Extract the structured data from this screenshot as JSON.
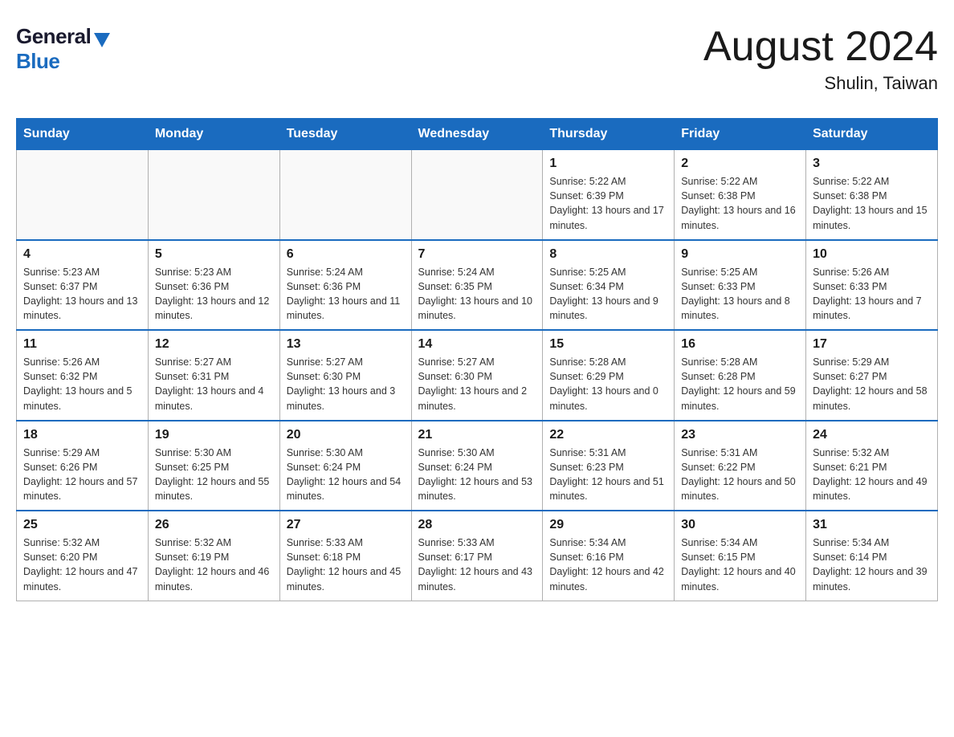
{
  "header": {
    "logo_general": "General",
    "logo_blue": "Blue",
    "month_title": "August 2024",
    "location": "Shulin, Taiwan"
  },
  "days_of_week": [
    "Sunday",
    "Monday",
    "Tuesday",
    "Wednesday",
    "Thursday",
    "Friday",
    "Saturday"
  ],
  "weeks": [
    [
      {
        "day": "",
        "info": ""
      },
      {
        "day": "",
        "info": ""
      },
      {
        "day": "",
        "info": ""
      },
      {
        "day": "",
        "info": ""
      },
      {
        "day": "1",
        "info": "Sunrise: 5:22 AM\nSunset: 6:39 PM\nDaylight: 13 hours and 17 minutes."
      },
      {
        "day": "2",
        "info": "Sunrise: 5:22 AM\nSunset: 6:38 PM\nDaylight: 13 hours and 16 minutes."
      },
      {
        "day": "3",
        "info": "Sunrise: 5:22 AM\nSunset: 6:38 PM\nDaylight: 13 hours and 15 minutes."
      }
    ],
    [
      {
        "day": "4",
        "info": "Sunrise: 5:23 AM\nSunset: 6:37 PM\nDaylight: 13 hours and 13 minutes."
      },
      {
        "day": "5",
        "info": "Sunrise: 5:23 AM\nSunset: 6:36 PM\nDaylight: 13 hours and 12 minutes."
      },
      {
        "day": "6",
        "info": "Sunrise: 5:24 AM\nSunset: 6:36 PM\nDaylight: 13 hours and 11 minutes."
      },
      {
        "day": "7",
        "info": "Sunrise: 5:24 AM\nSunset: 6:35 PM\nDaylight: 13 hours and 10 minutes."
      },
      {
        "day": "8",
        "info": "Sunrise: 5:25 AM\nSunset: 6:34 PM\nDaylight: 13 hours and 9 minutes."
      },
      {
        "day": "9",
        "info": "Sunrise: 5:25 AM\nSunset: 6:33 PM\nDaylight: 13 hours and 8 minutes."
      },
      {
        "day": "10",
        "info": "Sunrise: 5:26 AM\nSunset: 6:33 PM\nDaylight: 13 hours and 7 minutes."
      }
    ],
    [
      {
        "day": "11",
        "info": "Sunrise: 5:26 AM\nSunset: 6:32 PM\nDaylight: 13 hours and 5 minutes."
      },
      {
        "day": "12",
        "info": "Sunrise: 5:27 AM\nSunset: 6:31 PM\nDaylight: 13 hours and 4 minutes."
      },
      {
        "day": "13",
        "info": "Sunrise: 5:27 AM\nSunset: 6:30 PM\nDaylight: 13 hours and 3 minutes."
      },
      {
        "day": "14",
        "info": "Sunrise: 5:27 AM\nSunset: 6:30 PM\nDaylight: 13 hours and 2 minutes."
      },
      {
        "day": "15",
        "info": "Sunrise: 5:28 AM\nSunset: 6:29 PM\nDaylight: 13 hours and 0 minutes."
      },
      {
        "day": "16",
        "info": "Sunrise: 5:28 AM\nSunset: 6:28 PM\nDaylight: 12 hours and 59 minutes."
      },
      {
        "day": "17",
        "info": "Sunrise: 5:29 AM\nSunset: 6:27 PM\nDaylight: 12 hours and 58 minutes."
      }
    ],
    [
      {
        "day": "18",
        "info": "Sunrise: 5:29 AM\nSunset: 6:26 PM\nDaylight: 12 hours and 57 minutes."
      },
      {
        "day": "19",
        "info": "Sunrise: 5:30 AM\nSunset: 6:25 PM\nDaylight: 12 hours and 55 minutes."
      },
      {
        "day": "20",
        "info": "Sunrise: 5:30 AM\nSunset: 6:24 PM\nDaylight: 12 hours and 54 minutes."
      },
      {
        "day": "21",
        "info": "Sunrise: 5:30 AM\nSunset: 6:24 PM\nDaylight: 12 hours and 53 minutes."
      },
      {
        "day": "22",
        "info": "Sunrise: 5:31 AM\nSunset: 6:23 PM\nDaylight: 12 hours and 51 minutes."
      },
      {
        "day": "23",
        "info": "Sunrise: 5:31 AM\nSunset: 6:22 PM\nDaylight: 12 hours and 50 minutes."
      },
      {
        "day": "24",
        "info": "Sunrise: 5:32 AM\nSunset: 6:21 PM\nDaylight: 12 hours and 49 minutes."
      }
    ],
    [
      {
        "day": "25",
        "info": "Sunrise: 5:32 AM\nSunset: 6:20 PM\nDaylight: 12 hours and 47 minutes."
      },
      {
        "day": "26",
        "info": "Sunrise: 5:32 AM\nSunset: 6:19 PM\nDaylight: 12 hours and 46 minutes."
      },
      {
        "day": "27",
        "info": "Sunrise: 5:33 AM\nSunset: 6:18 PM\nDaylight: 12 hours and 45 minutes."
      },
      {
        "day": "28",
        "info": "Sunrise: 5:33 AM\nSunset: 6:17 PM\nDaylight: 12 hours and 43 minutes."
      },
      {
        "day": "29",
        "info": "Sunrise: 5:34 AM\nSunset: 6:16 PM\nDaylight: 12 hours and 42 minutes."
      },
      {
        "day": "30",
        "info": "Sunrise: 5:34 AM\nSunset: 6:15 PM\nDaylight: 12 hours and 40 minutes."
      },
      {
        "day": "31",
        "info": "Sunrise: 5:34 AM\nSunset: 6:14 PM\nDaylight: 12 hours and 39 minutes."
      }
    ]
  ]
}
